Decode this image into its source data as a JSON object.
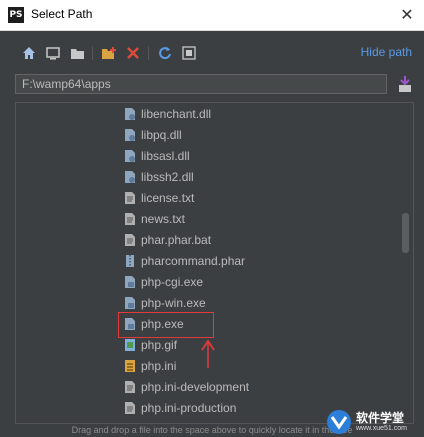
{
  "window": {
    "app_icon": "PS",
    "title": "Select Path",
    "close_glyph": "✕"
  },
  "toolbar": {
    "buttons": [
      "home-icon",
      "desktop-icon",
      "folder-icon",
      "new-folder-icon",
      "delete-icon",
      "refresh-icon",
      "show-hidden-icon"
    ],
    "hide_path_label": "Hide path"
  },
  "path": {
    "value": "F:\\wamp64\\apps"
  },
  "files": [
    {
      "name": "libenchant.dll",
      "icon": "dll-file-icon"
    },
    {
      "name": "libpq.dll",
      "icon": "dll-file-icon"
    },
    {
      "name": "libsasl.dll",
      "icon": "dll-file-icon"
    },
    {
      "name": "libssh2.dll",
      "icon": "dll-file-icon"
    },
    {
      "name": "license.txt",
      "icon": "text-file-icon"
    },
    {
      "name": "news.txt",
      "icon": "text-file-icon"
    },
    {
      "name": "phar.phar.bat",
      "icon": "text-file-icon"
    },
    {
      "name": "pharcommand.phar",
      "icon": "archive-file-icon"
    },
    {
      "name": "php-cgi.exe",
      "icon": "exe-file-icon"
    },
    {
      "name": "php-win.exe",
      "icon": "exe-file-icon"
    },
    {
      "name": "php.exe",
      "icon": "exe-file-icon"
    },
    {
      "name": "php.gif",
      "icon": "image-file-icon"
    },
    {
      "name": "php.ini",
      "icon": "ini-file-icon"
    },
    {
      "name": "php.ini-development",
      "icon": "text-file-icon"
    },
    {
      "name": "php.ini-production",
      "icon": "text-file-icon"
    }
  ],
  "status": {
    "text": "Drag and drop a file into the space above to quickly locate it in the tree"
  },
  "watermark": {
    "title": "软件学堂",
    "subtitle": "www.xue51.com"
  },
  "colors": {
    "background": "#3c3f41",
    "text": "#bbbbbb",
    "link": "#5a9be8",
    "highlight": "#e03a3a"
  }
}
